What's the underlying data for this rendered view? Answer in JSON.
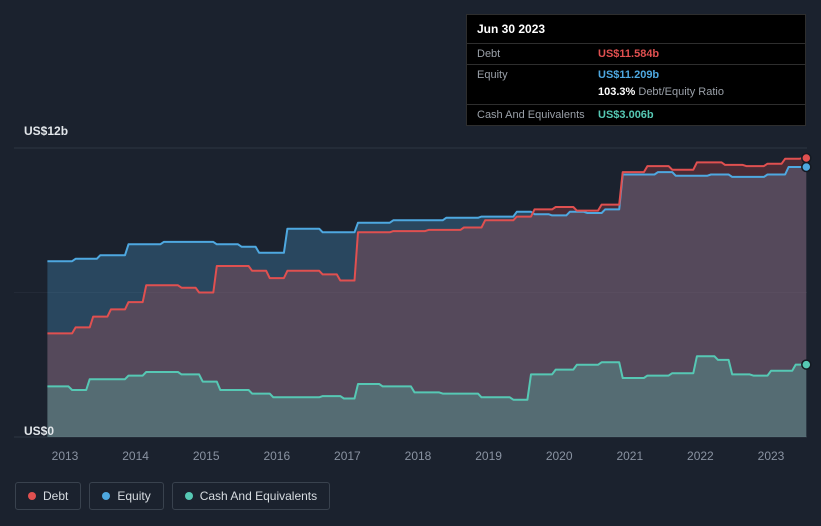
{
  "tooltip": {
    "date": "Jun 30 2023",
    "rows": {
      "debt_label": "Debt",
      "debt_value": "US$11.584b",
      "equity_label": "Equity",
      "equity_value": "US$11.209b",
      "ratio_value": "103.3%",
      "ratio_label": "Debt/Equity Ratio",
      "cash_label": "Cash And Equivalents",
      "cash_value": "US$3.006b"
    }
  },
  "y_axis": {
    "top_label": "US$12b",
    "bottom_label": "US$0"
  },
  "x_axis": {
    "ticks": [
      "2013",
      "2014",
      "2015",
      "2016",
      "2017",
      "2018",
      "2019",
      "2020",
      "2021",
      "2022",
      "2023"
    ]
  },
  "legend": [
    {
      "label": "Debt",
      "color": "#e05050"
    },
    {
      "label": "Equity",
      "color": "#4ea8e0"
    },
    {
      "label": "Cash And Equivalents",
      "color": "#56c8b4"
    }
  ],
  "colors": {
    "background": "#1b222e",
    "gridline": "#2d3542",
    "debt": "#e05050",
    "equity": "#4ea8e0",
    "cash": "#56c8b4"
  },
  "chart_data": {
    "type": "area",
    "title": "Debt, Equity and Cash And Equivalents over time",
    "x_unit": "year",
    "y_unit": "US$ billions",
    "xlim": [
      2012.75,
      2023.5
    ],
    "ylim": [
      0,
      12
    ],
    "legend_position": "bottom-left",
    "gridlines": [
      {
        "value": 12,
        "opacity": 1
      },
      {
        "value": 6,
        "opacity": 0.45
      },
      {
        "value": 0,
        "opacity": 1
      }
    ],
    "latest": {
      "date": "Jun 30 2023",
      "debt": 11.584,
      "equity": 11.209,
      "cash": 3.006,
      "debt_equity_ratio_pct": 103.3
    },
    "series": [
      {
        "name": "Equity",
        "color": "#4ea8e0",
        "fill": "rgba(78,168,224,0.28)",
        "points": [
          [
            2012.75,
            7.3
          ],
          [
            2013.1,
            7.3
          ],
          [
            2013.15,
            7.4
          ],
          [
            2013.45,
            7.4
          ],
          [
            2013.5,
            7.55
          ],
          [
            2013.85,
            7.55
          ],
          [
            2013.9,
            8.0
          ],
          [
            2014.35,
            8.0
          ],
          [
            2014.4,
            8.1
          ],
          [
            2015.1,
            8.1
          ],
          [
            2015.15,
            8.0
          ],
          [
            2015.45,
            8.0
          ],
          [
            2015.5,
            7.9
          ],
          [
            2015.7,
            7.9
          ],
          [
            2015.75,
            7.65
          ],
          [
            2016.1,
            7.65
          ],
          [
            2016.15,
            8.65
          ],
          [
            2016.6,
            8.65
          ],
          [
            2016.65,
            8.5
          ],
          [
            2017.1,
            8.5
          ],
          [
            2017.15,
            8.9
          ],
          [
            2017.6,
            8.9
          ],
          [
            2017.65,
            9.0
          ],
          [
            2018.35,
            9.0
          ],
          [
            2018.4,
            9.1
          ],
          [
            2018.85,
            9.1
          ],
          [
            2018.9,
            9.15
          ],
          [
            2019.35,
            9.15
          ],
          [
            2019.4,
            9.35
          ],
          [
            2019.6,
            9.35
          ],
          [
            2019.65,
            9.25
          ],
          [
            2019.85,
            9.25
          ],
          [
            2019.9,
            9.2
          ],
          [
            2020.1,
            9.2
          ],
          [
            2020.15,
            9.35
          ],
          [
            2020.35,
            9.35
          ],
          [
            2020.4,
            9.3
          ],
          [
            2020.6,
            9.3
          ],
          [
            2020.65,
            9.45
          ],
          [
            2020.85,
            9.45
          ],
          [
            2020.9,
            10.9
          ],
          [
            2021.35,
            10.9
          ],
          [
            2021.4,
            11.0
          ],
          [
            2021.6,
            11.0
          ],
          [
            2021.65,
            10.85
          ],
          [
            2022.1,
            10.85
          ],
          [
            2022.15,
            10.9
          ],
          [
            2022.4,
            10.9
          ],
          [
            2022.45,
            10.8
          ],
          [
            2022.9,
            10.8
          ],
          [
            2022.95,
            10.9
          ],
          [
            2023.2,
            10.9
          ],
          [
            2023.25,
            11.209
          ],
          [
            2023.5,
            11.209
          ]
        ]
      },
      {
        "name": "Debt",
        "color": "#e05050",
        "fill": "rgba(224,80,80,0.24)",
        "points": [
          [
            2012.75,
            4.3
          ],
          [
            2013.1,
            4.3
          ],
          [
            2013.15,
            4.55
          ],
          [
            2013.35,
            4.55
          ],
          [
            2013.4,
            5.0
          ],
          [
            2013.6,
            5.0
          ],
          [
            2013.65,
            5.3
          ],
          [
            2013.85,
            5.3
          ],
          [
            2013.9,
            5.6
          ],
          [
            2014.1,
            5.6
          ],
          [
            2014.15,
            6.3
          ],
          [
            2014.6,
            6.3
          ],
          [
            2014.65,
            6.2
          ],
          [
            2014.85,
            6.2
          ],
          [
            2014.9,
            6.0
          ],
          [
            2015.1,
            6.0
          ],
          [
            2015.15,
            7.1
          ],
          [
            2015.6,
            7.1
          ],
          [
            2015.65,
            6.9
          ],
          [
            2015.85,
            6.9
          ],
          [
            2015.9,
            6.6
          ],
          [
            2016.1,
            6.6
          ],
          [
            2016.15,
            6.9
          ],
          [
            2016.6,
            6.9
          ],
          [
            2016.65,
            6.75
          ],
          [
            2016.85,
            6.75
          ],
          [
            2016.9,
            6.5
          ],
          [
            2017.1,
            6.5
          ],
          [
            2017.15,
            8.5
          ],
          [
            2017.6,
            8.5
          ],
          [
            2017.65,
            8.55
          ],
          [
            2018.1,
            8.55
          ],
          [
            2018.15,
            8.6
          ],
          [
            2018.6,
            8.6
          ],
          [
            2018.65,
            8.7
          ],
          [
            2018.9,
            8.7
          ],
          [
            2018.95,
            9.0
          ],
          [
            2019.35,
            9.0
          ],
          [
            2019.4,
            9.15
          ],
          [
            2019.6,
            9.15
          ],
          [
            2019.65,
            9.45
          ],
          [
            2019.9,
            9.45
          ],
          [
            2019.95,
            9.55
          ],
          [
            2020.2,
            9.55
          ],
          [
            2020.25,
            9.4
          ],
          [
            2020.55,
            9.4
          ],
          [
            2020.6,
            9.65
          ],
          [
            2020.85,
            9.65
          ],
          [
            2020.9,
            11.0
          ],
          [
            2021.2,
            11.0
          ],
          [
            2021.25,
            11.25
          ],
          [
            2021.55,
            11.25
          ],
          [
            2021.6,
            11.1
          ],
          [
            2021.9,
            11.1
          ],
          [
            2021.95,
            11.4
          ],
          [
            2022.3,
            11.4
          ],
          [
            2022.35,
            11.3
          ],
          [
            2022.6,
            11.3
          ],
          [
            2022.65,
            11.25
          ],
          [
            2022.9,
            11.25
          ],
          [
            2022.95,
            11.35
          ],
          [
            2023.15,
            11.35
          ],
          [
            2023.2,
            11.55
          ],
          [
            2023.4,
            11.55
          ],
          [
            2023.45,
            11.584
          ],
          [
            2023.5,
            11.584
          ]
        ]
      },
      {
        "name": "Cash And Equivalents",
        "color": "#56c8b4",
        "fill": "rgba(86,200,180,0.28)",
        "points": [
          [
            2012.75,
            2.1
          ],
          [
            2013.05,
            2.1
          ],
          [
            2013.1,
            1.95
          ],
          [
            2013.3,
            1.95
          ],
          [
            2013.35,
            2.4
          ],
          [
            2013.85,
            2.4
          ],
          [
            2013.9,
            2.55
          ],
          [
            2014.1,
            2.55
          ],
          [
            2014.15,
            2.7
          ],
          [
            2014.6,
            2.7
          ],
          [
            2014.65,
            2.6
          ],
          [
            2014.9,
            2.6
          ],
          [
            2014.95,
            2.3
          ],
          [
            2015.15,
            2.3
          ],
          [
            2015.2,
            1.95
          ],
          [
            2015.6,
            1.95
          ],
          [
            2015.65,
            1.8
          ],
          [
            2015.9,
            1.8
          ],
          [
            2015.95,
            1.65
          ],
          [
            2016.6,
            1.65
          ],
          [
            2016.65,
            1.7
          ],
          [
            2016.9,
            1.7
          ],
          [
            2016.95,
            1.6
          ],
          [
            2017.1,
            1.6
          ],
          [
            2017.15,
            2.2
          ],
          [
            2017.45,
            2.2
          ],
          [
            2017.5,
            2.1
          ],
          [
            2017.9,
            2.1
          ],
          [
            2017.95,
            1.85
          ],
          [
            2018.3,
            1.85
          ],
          [
            2018.35,
            1.8
          ],
          [
            2018.85,
            1.8
          ],
          [
            2018.9,
            1.65
          ],
          [
            2019.3,
            1.65
          ],
          [
            2019.35,
            1.55
          ],
          [
            2019.55,
            1.55
          ],
          [
            2019.6,
            2.6
          ],
          [
            2019.9,
            2.6
          ],
          [
            2019.95,
            2.8
          ],
          [
            2020.2,
            2.8
          ],
          [
            2020.25,
            3.0
          ],
          [
            2020.55,
            3.0
          ],
          [
            2020.6,
            3.1
          ],
          [
            2020.85,
            3.1
          ],
          [
            2020.9,
            2.45
          ],
          [
            2021.2,
            2.45
          ],
          [
            2021.25,
            2.55
          ],
          [
            2021.55,
            2.55
          ],
          [
            2021.6,
            2.65
          ],
          [
            2021.9,
            2.65
          ],
          [
            2021.95,
            3.35
          ],
          [
            2022.2,
            3.35
          ],
          [
            2022.25,
            3.2
          ],
          [
            2022.4,
            3.2
          ],
          [
            2022.45,
            2.6
          ],
          [
            2022.7,
            2.6
          ],
          [
            2022.75,
            2.55
          ],
          [
            2022.95,
            2.55
          ],
          [
            2023.0,
            2.75
          ],
          [
            2023.3,
            2.75
          ],
          [
            2023.35,
            3.006
          ],
          [
            2023.5,
            3.006
          ]
        ]
      }
    ]
  }
}
